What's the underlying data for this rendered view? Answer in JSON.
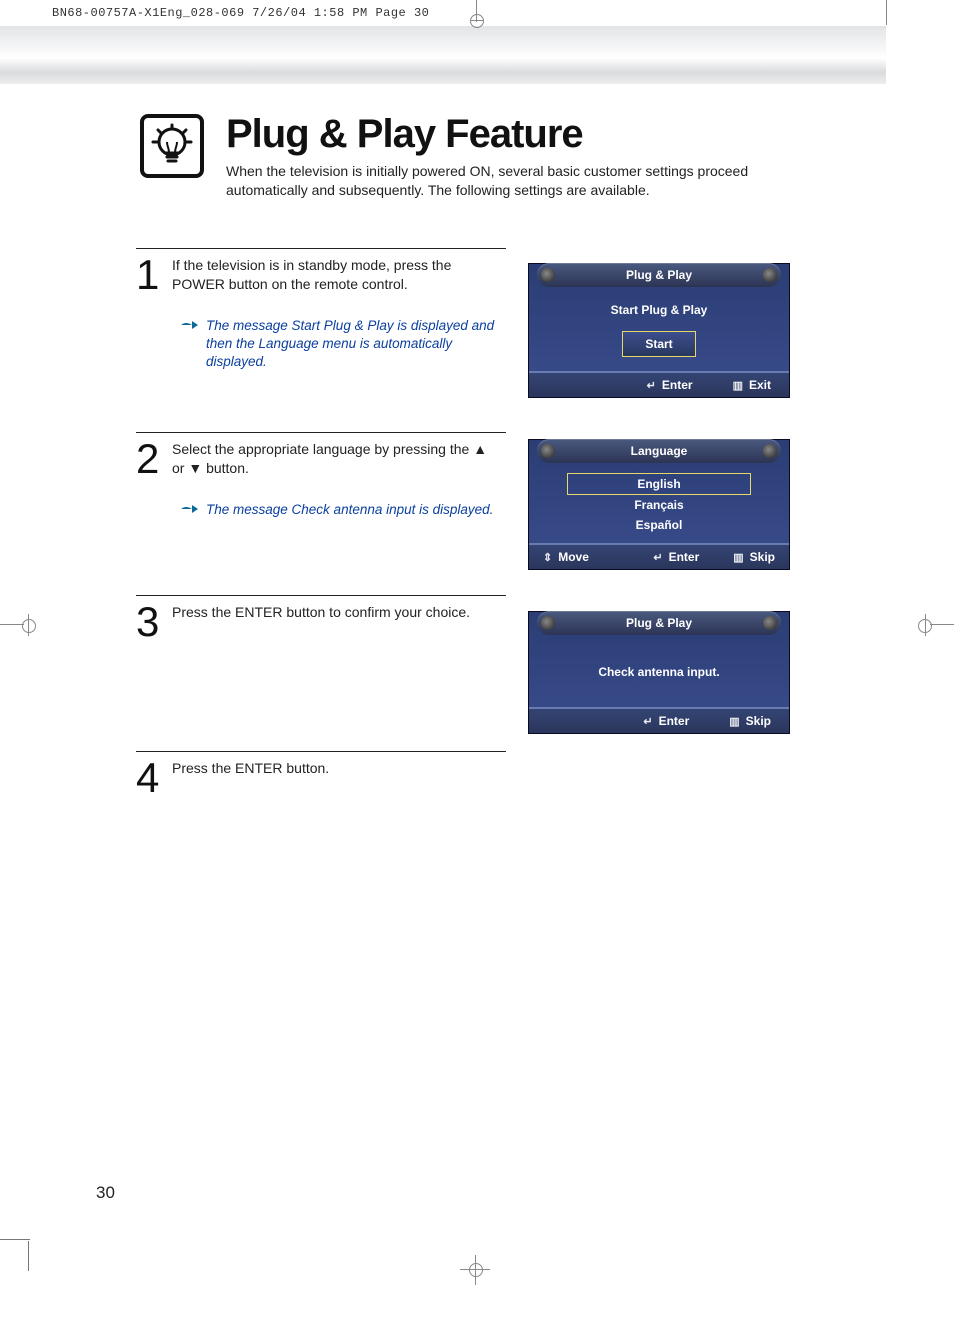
{
  "print_header": "BN68-00757A-X1Eng_028-069  7/26/04  1:58 PM  Page 30",
  "page_number": "30",
  "header": {
    "title": "Plug & Play Feature",
    "intro": "When the television is initially powered ON, several basic customer settings proceed automatically and subsequently. The following settings are available."
  },
  "steps": [
    {
      "num": "1",
      "text": "If the television is in standby mode, press the POWER button on the remote control.",
      "hint": "The message Start Plug & Play is displayed and then the Language menu is automatically displayed."
    },
    {
      "num": "2",
      "text": "Select the appropriate language by pressing the ▲ or ▼ button.",
      "hint": "The message Check antenna input is displayed."
    },
    {
      "num": "3",
      "text": "Press the ENTER button to confirm your choice."
    },
    {
      "num": "4",
      "text": "Press the ENTER button."
    }
  ],
  "osd1": {
    "title": "Plug & Play",
    "subtitle": "Start Plug & Play",
    "button": "Start",
    "footer_enter": "Enter",
    "footer_exit": "Exit"
  },
  "osd2": {
    "title": "Language",
    "options": [
      "English",
      "Français",
      "Español"
    ],
    "footer_move": "Move",
    "footer_enter": "Enter",
    "footer_skip": "Skip"
  },
  "osd3": {
    "title": "Plug & Play",
    "message": "Check antenna input.",
    "footer_enter": "Enter",
    "footer_skip": "Skip"
  }
}
